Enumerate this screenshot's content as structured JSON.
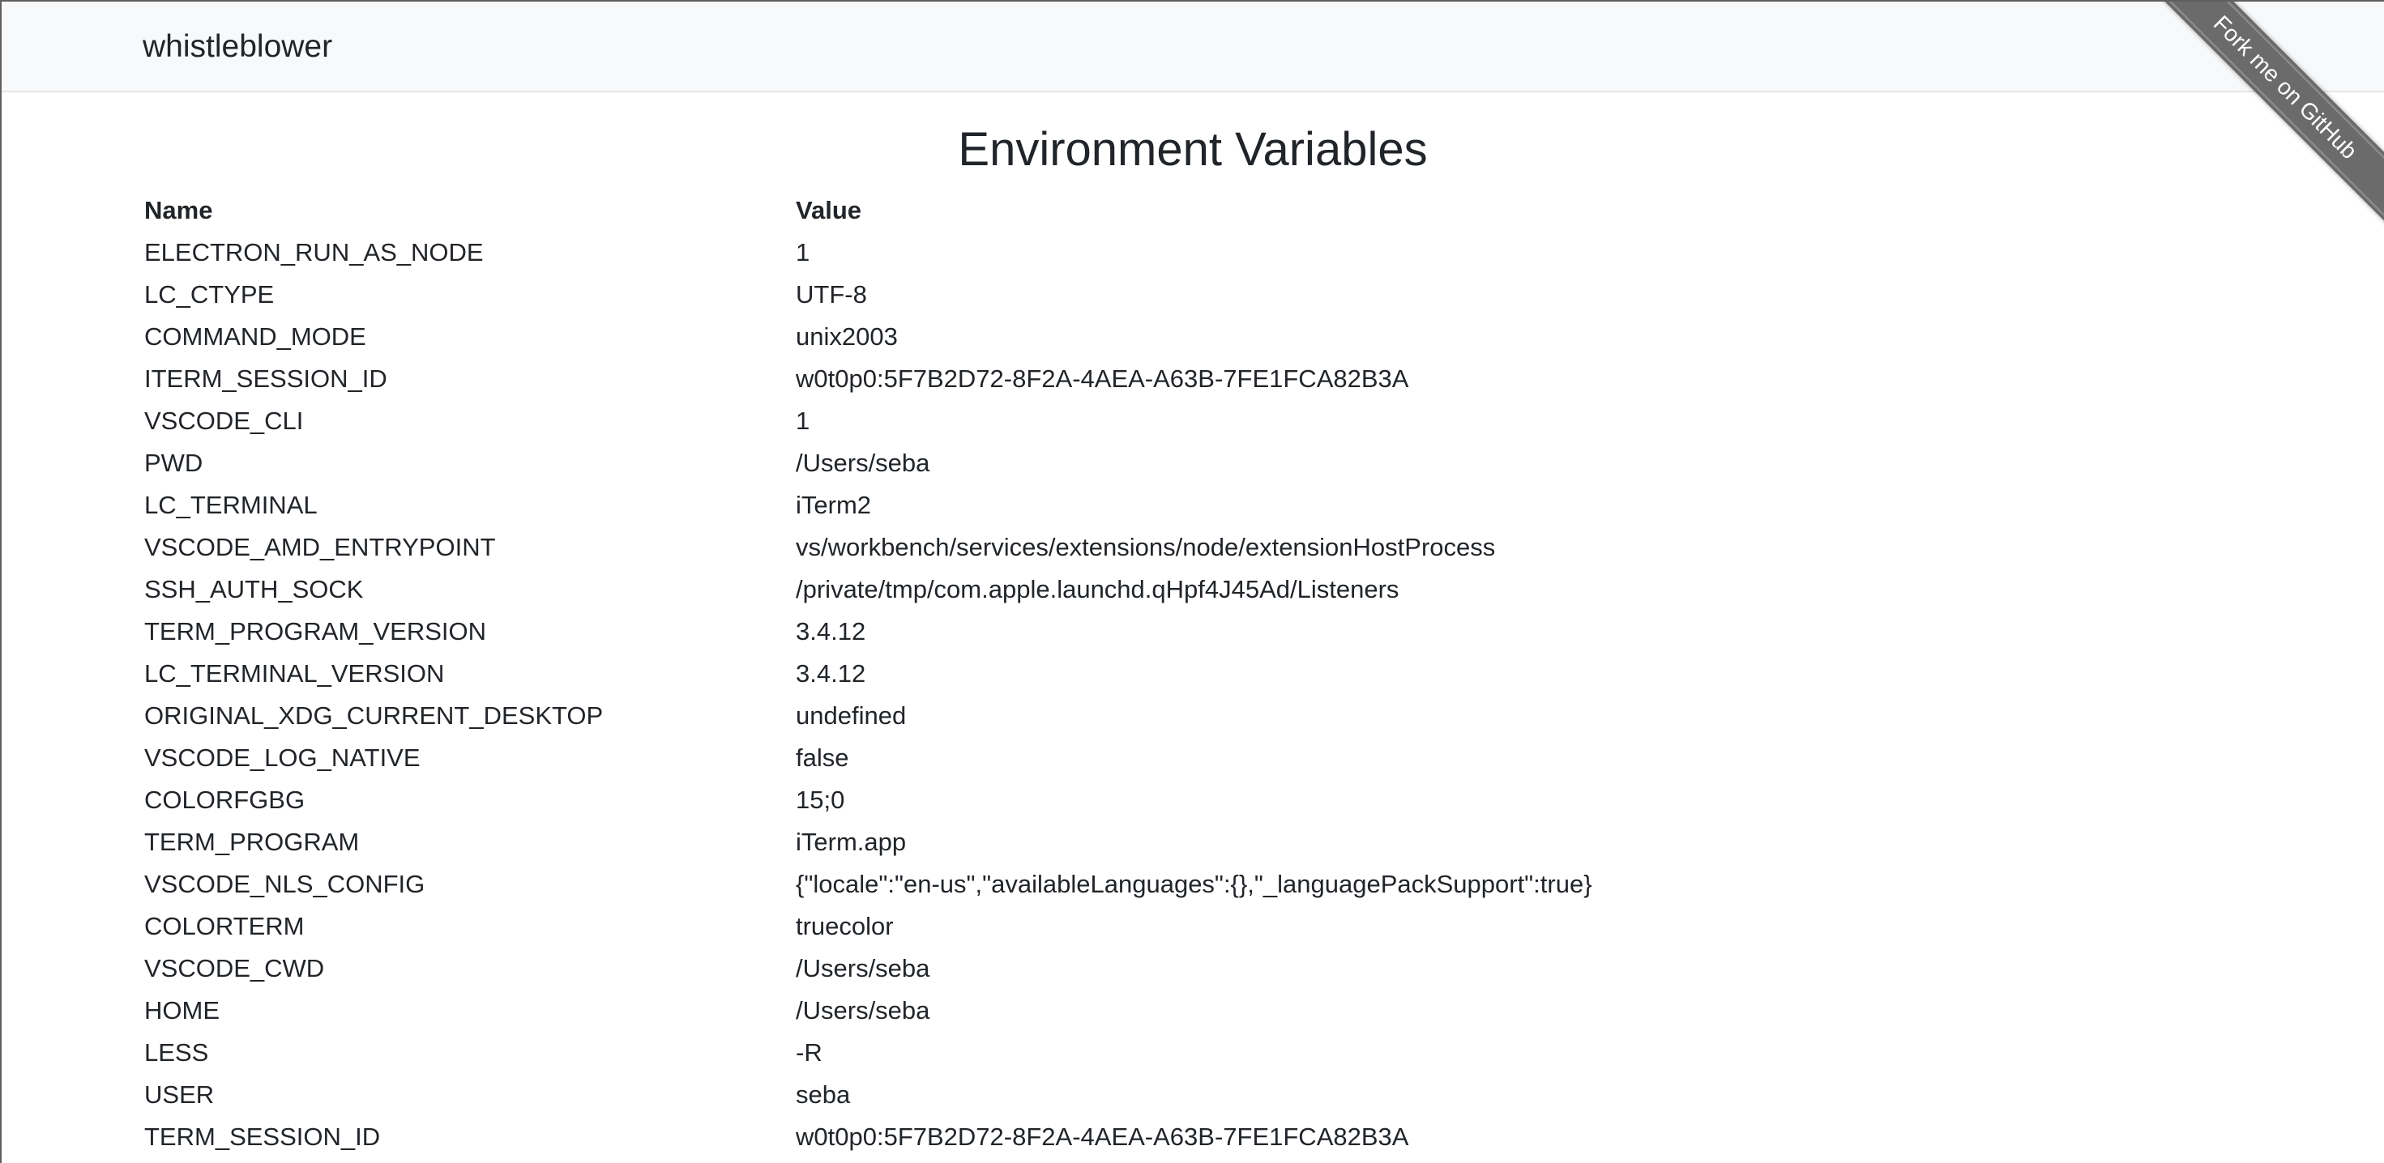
{
  "navbar": {
    "brand": "whistleblower"
  },
  "ribbon": {
    "label": "Fork me on GitHub"
  },
  "page": {
    "title": "Environment Variables"
  },
  "table": {
    "headers": [
      "Name",
      "Value"
    ],
    "rows": [
      [
        "ELECTRON_RUN_AS_NODE",
        "1"
      ],
      [
        "LC_CTYPE",
        "UTF-8"
      ],
      [
        "COMMAND_MODE",
        "unix2003"
      ],
      [
        "ITERM_SESSION_ID",
        "w0t0p0:5F7B2D72-8F2A-4AEA-A63B-7FE1FCA82B3A"
      ],
      [
        "VSCODE_CLI",
        "1"
      ],
      [
        "PWD",
        "/Users/seba"
      ],
      [
        "LC_TERMINAL",
        "iTerm2"
      ],
      [
        "VSCODE_AMD_ENTRYPOINT",
        "vs/workbench/services/extensions/node/extensionHostProcess"
      ],
      [
        "SSH_AUTH_SOCK",
        "/private/tmp/com.apple.launchd.qHpf4J45Ad/Listeners"
      ],
      [
        "TERM_PROGRAM_VERSION",
        "3.4.12"
      ],
      [
        "LC_TERMINAL_VERSION",
        "3.4.12"
      ],
      [
        "ORIGINAL_XDG_CURRENT_DESKTOP",
        "undefined"
      ],
      [
        "VSCODE_LOG_NATIVE",
        "false"
      ],
      [
        "COLORFGBG",
        "15;0"
      ],
      [
        "TERM_PROGRAM",
        "iTerm.app"
      ],
      [
        "VSCODE_NLS_CONFIG",
        "{\"locale\":\"en-us\",\"availableLanguages\":{},\"_languagePackSupport\":true}"
      ],
      [
        "COLORTERM",
        "truecolor"
      ],
      [
        "VSCODE_CWD",
        "/Users/seba"
      ],
      [
        "HOME",
        "/Users/seba"
      ],
      [
        "LESS",
        "-R"
      ],
      [
        "USER",
        "seba"
      ],
      [
        "TERM_SESSION_ID",
        "w0t0p0:5F7B2D72-8F2A-4AEA-A63B-7FE1FCA82B3A"
      ]
    ]
  }
}
